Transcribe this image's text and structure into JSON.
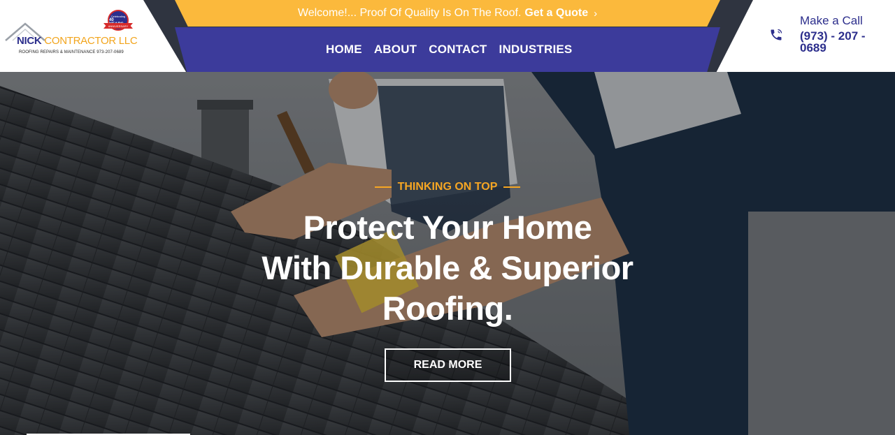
{
  "topbar": {
    "welcome_text": "Welcome!... Proof Of Quality Is On The Roof.",
    "quote_link": "Get a Quote",
    "chevron_icon": "chevron-right-icon"
  },
  "logo": {
    "brand_first": "NICK",
    "brand_rest": " CONTRACTOR LLC",
    "tagline": "ROOFING REPAIRS & MAINTENANCE 973-207-0689",
    "badge_top": "Celebrating",
    "badge_years": "40 YEARS",
    "badge_ribbon": "ANNIVERSARY"
  },
  "nav": {
    "items": [
      {
        "label": "HOME"
      },
      {
        "label": "ABOUT"
      },
      {
        "label": "CONTACT"
      },
      {
        "label": "INDUSTRIES"
      }
    ]
  },
  "call": {
    "label": "Make a Call",
    "number": "(973) - 207 - 0689",
    "icon": "phone-icon"
  },
  "hero": {
    "eyebrow": "THINKING ON TOP",
    "headline_line1": "Protect Your Home",
    "headline_line2": "With Durable & Superior",
    "headline_line3": "Roofing.",
    "button": "READ MORE"
  },
  "colors": {
    "accent_orange": "#fbb93c",
    "nav_blue": "#3c3b9b",
    "brand_navy": "#2c2e8c",
    "dark_band": "#2f3440"
  }
}
